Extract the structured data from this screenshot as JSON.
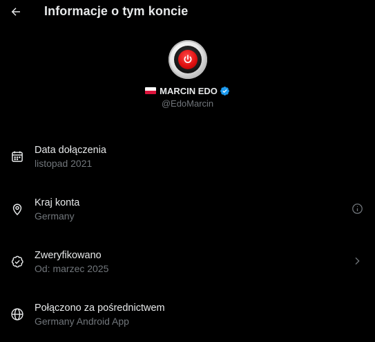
{
  "header": {
    "title": "Informacje o tym koncie",
    "back_icon": "arrow-left-icon"
  },
  "profile": {
    "display_name": "MARCIN EDO",
    "handle": "@EdoMarcin",
    "flag": "poland-flag-icon",
    "verified_icon": "verified-badge-icon",
    "verified_color": "#1d9bf0",
    "avatar": "red-power-button-avatar"
  },
  "details": [
    {
      "icon": "calendar-icon",
      "label": "Data dołączenia",
      "value": "listopad 2021"
    },
    {
      "icon": "location-pin-icon",
      "label": "Kraj konta",
      "value": "Germany",
      "trail_icon": "info-icon"
    },
    {
      "icon": "verified-check-icon",
      "label": "Zweryfikowano",
      "value": "Od: marzec 2025",
      "trail_icon": "chevron-right-icon"
    },
    {
      "icon": "globe-icon",
      "label": "Połączono za pośrednictwem",
      "value": "Germany Android App"
    }
  ],
  "colors": {
    "background": "#000000",
    "text_primary": "#e7e9ea",
    "text_secondary": "#71767b",
    "accent": "#1d9bf0"
  }
}
